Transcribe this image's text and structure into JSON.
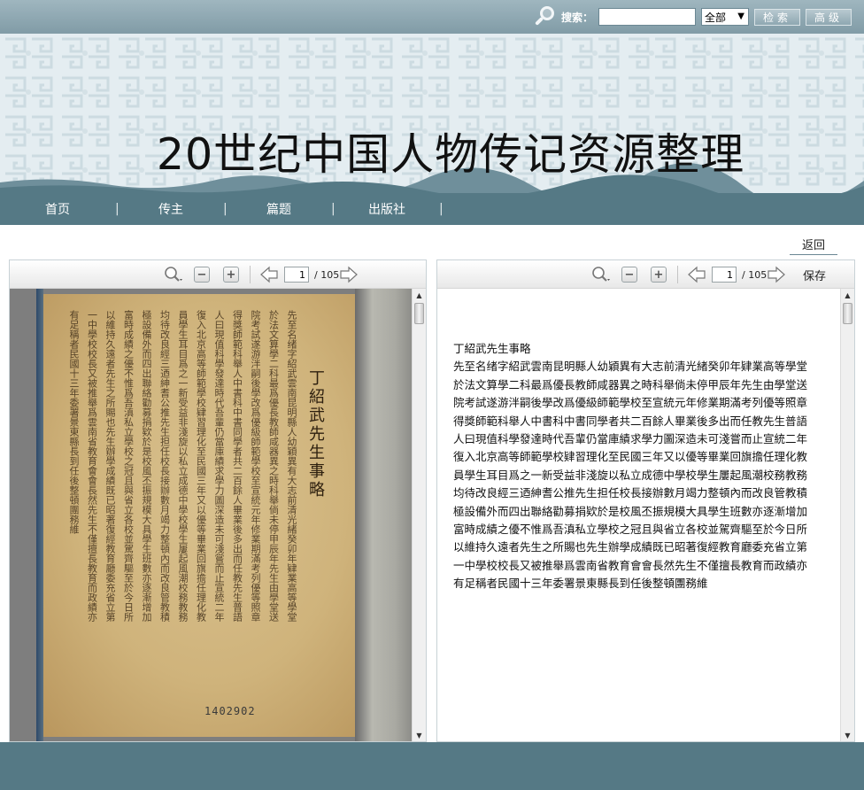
{
  "search": {
    "label": "搜索：",
    "input_value": "",
    "scope_selected": "全部",
    "search_button": "检索",
    "advanced_button": "高级"
  },
  "banner": {
    "title": "20世纪中国人物传记资源整理"
  },
  "nav": {
    "items": [
      {
        "label": "首页"
      },
      {
        "label": "传主"
      },
      {
        "label": "篇题"
      },
      {
        "label": "出版社"
      }
    ],
    "separator": "|"
  },
  "back_link": "返回",
  "left_viewer": {
    "page_current": "1",
    "page_total": "/  105",
    "scan": {
      "title": "丁紹武先生事略",
      "stamp": "1402902"
    }
  },
  "right_viewer": {
    "page_current": "1",
    "page_total": "/  105",
    "save_label": "保存",
    "text": {
      "heading": "丁紹武先生事略",
      "lines": [
        "先至名绪字紹武雲南昆明縣人幼穎異有大志前清光緒癸卯年肄業高等學堂",
        "於法文算學二科最爲優長教師咸器異之時科舉倘未停甲辰年先生由學堂送",
        "院考試遂游泮嗣後學改爲優級師範學校至宣統元年修業期滿考列優等照章",
        "得獎師範科舉人中書科中書同學者共二百餘人畢業後多出而任教先生普語",
        "人曰現值科學發達時代吾輩仍當庫績求學力圖深造未可淺嘗而止宣統二年",
        "復入北京高等師範學校肄習理化至民國三年又以優等畢業回旗擔任理化教",
        "員學生耳目爲之一新受益非淺旋以私立成德中學校學生屢起風潮校務教務",
        "均待改良經三迺紳耆公推先生担任校長接辦數月竭力整頓內而改良管教積",
        "極設備外而四出聯絡勸募捐欵於是校風丕振規模大具學生班數亦逐漸增加",
        "富時成績之優不惟爲吾滇私立學校之冠且與省立各校並駕齊驅至於今日所",
        "以維持久遠者先生之所賜也先生辦學成績既已昭著復經教育廳委充省立第",
        "一中學校校長又被推舉爲雲南省教育會會長然先生不僅擅長教育而政績亦",
        "有足稱者民國十三年委署景東縣長到任後整頓團務維"
      ]
    }
  },
  "colors": {
    "nav_bar": "#557985",
    "top_bar": "#8fa8b2",
    "banner_bg": "#dfe9ee",
    "paper": "#d2b77f"
  }
}
